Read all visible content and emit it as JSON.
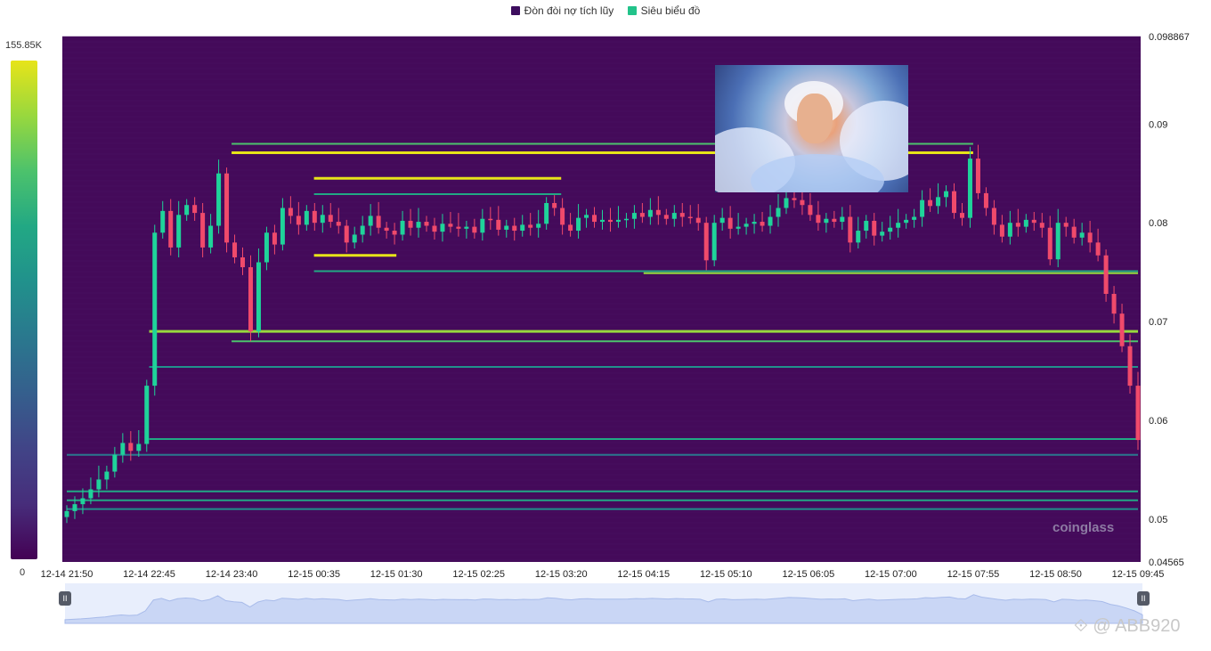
{
  "legend": [
    {
      "label": "Đòn đòi nợ tích lũy",
      "color": "#3d0d5e"
    },
    {
      "label": "Siêu biểu đồ",
      "color": "#22c38a"
    }
  ],
  "colorbar": {
    "max_label": "155.85K",
    "min_label": "0"
  },
  "watermark": "coinglass",
  "brand": "⟐ @ ABB920",
  "chart_data": {
    "type": "heatmap",
    "overlay": "candlestick",
    "y_range": [
      0.04565,
      0.098867
    ],
    "y_ticks": [
      "0.098867",
      "0.09",
      "0.08",
      "0.07",
      "0.06",
      "0.05",
      "0.04565"
    ],
    "x_ticks": [
      "12-14 21:50",
      "12-14 22:45",
      "12-14 23:40",
      "12-15 00:35",
      "12-15 01:30",
      "12-15 02:25",
      "12-15 03:20",
      "12-15 04:15",
      "12-15 05:10",
      "12-15 06:05",
      "12-15 07:00",
      "12-15 07:55",
      "12-15 08:50",
      "12-15 09:45"
    ],
    "close": [
      0.0508,
      0.0515,
      0.0521,
      0.053,
      0.054,
      0.0548,
      0.0565,
      0.0577,
      0.0569,
      0.0576,
      0.0635,
      0.079,
      0.0812,
      0.0775,
      0.0808,
      0.0818,
      0.081,
      0.0775,
      0.0797,
      0.085,
      0.078,
      0.0765,
      0.0755,
      0.069,
      0.076,
      0.079,
      0.0778,
      0.0815,
      0.0807,
      0.0798,
      0.0812,
      0.08,
      0.0808,
      0.0801,
      0.0797,
      0.078,
      0.0788,
      0.0797,
      0.0807,
      0.0795,
      0.0792,
      0.0788,
      0.0802,
      0.0795,
      0.0801,
      0.0797,
      0.0791,
      0.0799,
      0.0796,
      0.0794,
      0.0796,
      0.079,
      0.0804,
      0.0803,
      0.0793,
      0.0797,
      0.0792,
      0.0798,
      0.0795,
      0.0799,
      0.082,
      0.0815,
      0.0798,
      0.0792,
      0.0805,
      0.0808,
      0.0801,
      0.0803,
      0.0801,
      0.0803,
      0.0804,
      0.081,
      0.0806,
      0.0813,
      0.0808,
      0.0804,
      0.081,
      0.0806,
      0.0805,
      0.08,
      0.0762,
      0.08,
      0.0805,
      0.0794,
      0.0796,
      0.0799,
      0.0801,
      0.0797,
      0.0806,
      0.0815,
      0.0825,
      0.0823,
      0.0818,
      0.0808,
      0.08,
      0.0804,
      0.0801,
      0.0806,
      0.078,
      0.0792,
      0.0802,
      0.0787,
      0.0791,
      0.0795,
      0.08,
      0.0803,
      0.0806,
      0.0823,
      0.0817,
      0.0826,
      0.0832,
      0.081,
      0.0805,
      0.0865,
      0.083,
      0.0815,
      0.0798,
      0.0786,
      0.08,
      0.0796,
      0.0803,
      0.08,
      0.0795,
      0.0763,
      0.08,
      0.0796,
      0.0785,
      0.079,
      0.078,
      0.0767,
      0.0728,
      0.0708,
      0.0675,
      0.0635,
      0.058
    ],
    "liquidation_levels": [
      {
        "price": 0.088,
        "from": "12-14 23:40",
        "to": "12-15 07:55",
        "intensity": 0.7
      },
      {
        "price": 0.0871,
        "from": "12-14 23:40",
        "to": "12-15 07:55",
        "intensity": 0.95
      },
      {
        "price": 0.0845,
        "from": "12-15 00:35",
        "to": "12-15 03:20",
        "intensity": 1.0
      },
      {
        "price": 0.0829,
        "from": "12-15 00:35",
        "to": "12-15 03:20",
        "intensity": 0.6
      },
      {
        "price": 0.0767,
        "from": "12-15 00:35",
        "to": "12-15 01:30",
        "intensity": 1.0
      },
      {
        "price": 0.0751,
        "from": "12-15 00:35",
        "to": "12-15 09:45",
        "intensity": 0.55
      },
      {
        "price": 0.0749,
        "from": "12-15 04:15",
        "to": "12-15 09:45",
        "intensity": 0.8
      },
      {
        "price": 0.069,
        "from": "12-14 22:45",
        "to": "12-15 09:45",
        "intensity": 0.85
      },
      {
        "price": 0.068,
        "from": "12-14 23:40",
        "to": "12-15 09:45",
        "intensity": 0.7
      },
      {
        "price": 0.0654,
        "from": "12-14 22:45",
        "to": "12-15 09:45",
        "intensity": 0.4
      },
      {
        "price": 0.0581,
        "from": "12-14 22:45",
        "to": "12-15 09:45",
        "intensity": 0.55
      },
      {
        "price": 0.0565,
        "from": "12-14 21:50",
        "to": "12-15 09:45",
        "intensity": 0.35
      },
      {
        "price": 0.0528,
        "from": "12-14 21:50",
        "to": "12-15 09:45",
        "intensity": 0.5
      },
      {
        "price": 0.0519,
        "from": "12-14 21:50",
        "to": "12-15 09:45",
        "intensity": 0.5
      },
      {
        "price": 0.051,
        "from": "12-14 21:50",
        "to": "12-15 09:45",
        "intensity": 0.4
      }
    ]
  }
}
